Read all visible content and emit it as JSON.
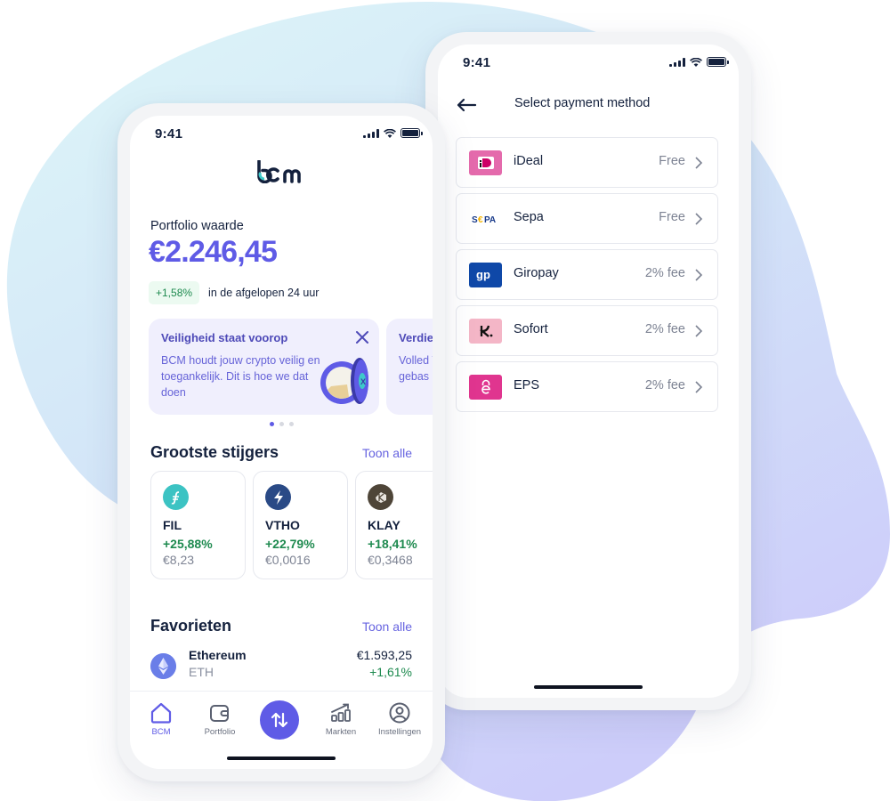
{
  "colors": {
    "accent": "#5f5be6",
    "positive": "#1e8a4f",
    "text": "#14213d",
    "muted": "#7d8393"
  },
  "home_phone": {
    "status_bar": {
      "time": "9:41"
    },
    "logo": "bcm",
    "portfolio": {
      "label": "Portfolio waarde",
      "value": "€2.246,45",
      "change_badge": "+1,58%",
      "change_text": "in de afgelopen 24 uur"
    },
    "promos": [
      {
        "title": "Veiligheid staat voorop",
        "body": "BCM houdt jouw crypto veilig en toegankelijk. Dit is hoe we dat doen",
        "icon": "close-icon"
      },
      {
        "title": "Verdie",
        "body": "Volled Veilig - gebas"
      }
    ],
    "carousel": {
      "pages": 3,
      "active_page": 1
    },
    "gainers_section": {
      "title": "Grootste stijgers",
      "link": "Toon alle",
      "items": [
        {
          "symbol": "FIL",
          "change": "+25,88%",
          "price": "€8,23",
          "icon": "filecoin-icon",
          "color": "#3cc3c3"
        },
        {
          "symbol": "VTHO",
          "change": "+22,79%",
          "price": "€0,0016",
          "icon": "vethor-icon",
          "color": "#2a4a86"
        },
        {
          "symbol": "KLAY",
          "change": "+18,41%",
          "price": "€0,3468",
          "icon": "klaytn-icon",
          "color": "#4e4538"
        }
      ]
    },
    "favorites_section": {
      "title": "Favorieten",
      "link": "Toon alle",
      "items": [
        {
          "name": "Ethereum",
          "symbol": "ETH",
          "price": "€1.593,25",
          "change": "+1,61%",
          "icon": "ethereum-icon"
        }
      ]
    },
    "tabbar": {
      "items": [
        {
          "label": "BCM",
          "icon": "home-icon",
          "active": true
        },
        {
          "label": "Portfolio",
          "icon": "wallet-icon",
          "active": false
        },
        {
          "label": "",
          "icon": "transfer-icon",
          "active": false
        },
        {
          "label": "Markten",
          "icon": "chart-icon",
          "active": false
        },
        {
          "label": "Instellingen",
          "icon": "user-icon",
          "active": false
        }
      ]
    }
  },
  "payment_phone": {
    "status_bar": {
      "time": "9:41"
    },
    "title": "Select payment method",
    "methods": [
      {
        "name": "iDeal",
        "fee": "Free",
        "icon": "ideal-logo",
        "color": "#e46aac"
      },
      {
        "name": "Sepa",
        "fee": "Free",
        "icon": "sepa-logo",
        "color": "#ffffff"
      },
      {
        "name": "Giropay",
        "fee": "2% fee",
        "icon": "giropay-logo",
        "color": "#0f48a8"
      },
      {
        "name": "Sofort",
        "fee": "2% fee",
        "icon": "klarna-logo",
        "color": "#f4b6c7"
      },
      {
        "name": "EPS",
        "fee": "2% fee",
        "icon": "eps-logo",
        "color": "#e0358f"
      }
    ]
  }
}
